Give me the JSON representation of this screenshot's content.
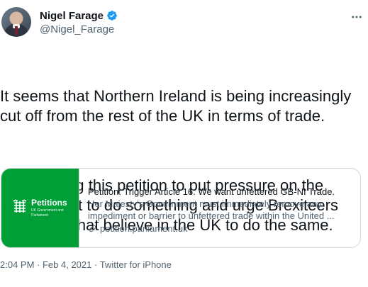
{
  "author": {
    "display_name": "Nigel Farage",
    "handle": "@Nigel_Farage",
    "verified": true
  },
  "tweet": {
    "paragraphs": [
      "It seems that Northern Ireland is being increasingly cut off from the rest of the UK in terms of trade.",
      "I am signing this petition to put pressure on the government to do something and urge Brexiteers and those that believe in the UK to do the same."
    ]
  },
  "card": {
    "thumb_title": "Petitions",
    "thumb_subtitle": "UK Government and Parliament",
    "title": "Petition: Trigger Article 16. We want unfettered GB-NI Trade.",
    "description": "Her Majesty's Government must immediately remove any impediment or barrier to unfettered trade within the United ...",
    "domain": "petition.parliament.uk",
    "thumb_color": "#009e36"
  },
  "meta": {
    "time": "2:04 PM",
    "separator1": " · ",
    "date": "Feb 4, 2021",
    "separator2": " · ",
    "source": "Twitter for iPhone"
  },
  "colors": {
    "text": "#0f1419",
    "secondary": "#536471",
    "verified_blue": "#1d9bf0",
    "border": "#cfd9de"
  },
  "icons": {
    "more": "more-icon",
    "verified": "verified-badge-icon",
    "link": "link-icon",
    "portcullis": "portcullis-icon"
  }
}
